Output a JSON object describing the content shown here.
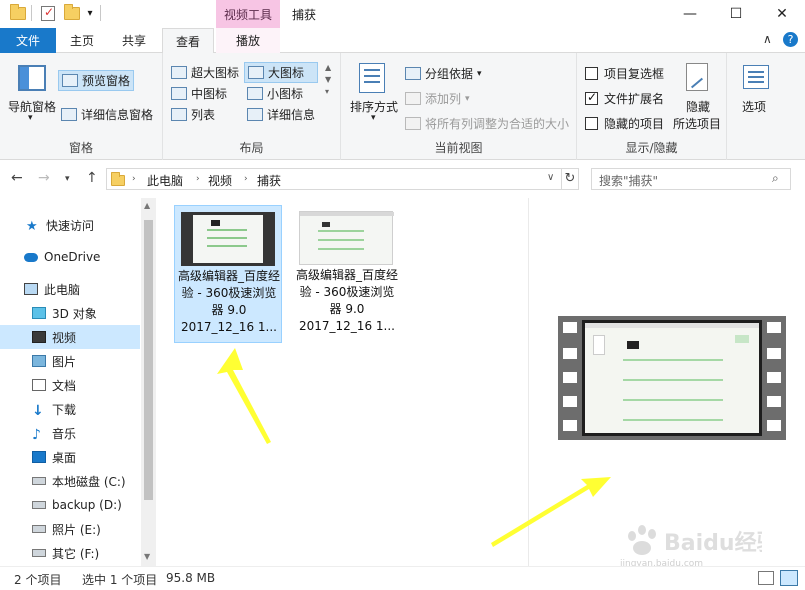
{
  "window": {
    "context_tool_label": "视频工具",
    "title": "捕获"
  },
  "tabs": {
    "file": "文件",
    "home": "主页",
    "share": "共享",
    "view": "查看",
    "play": "播放"
  },
  "ribbon": {
    "pane": {
      "nav_pane": "导航窗格",
      "preview_pane": "预览窗格",
      "details_pane": "详细信息窗格",
      "label": "窗格"
    },
    "layout": {
      "extra_large": "超大图标",
      "large": "大图标",
      "medium": "中图标",
      "small": "小图标",
      "list": "列表",
      "details": "详细信息",
      "label": "布局"
    },
    "current_view": {
      "sort_by": "排序方式",
      "group_by": "分组依据",
      "add_column": "添加列",
      "fit_columns": "将所有列调整为合适的大小",
      "label": "当前视图"
    },
    "show_hide": {
      "item_checkboxes": "项目复选框",
      "file_extensions": "文件扩展名",
      "hidden_items": "隐藏的项目",
      "hide_selected_1": "隐藏",
      "hide_selected_2": "所选项目",
      "label": "显示/隐藏"
    },
    "options": "选项"
  },
  "address": {
    "crumbs": [
      "此电脑",
      "视频",
      "捕获"
    ],
    "search_placeholder": "搜索\"捕获\""
  },
  "nav": {
    "items": [
      "快速访问",
      "OneDrive",
      "此电脑",
      "3D 对象",
      "视频",
      "图片",
      "文档",
      "下载",
      "音乐",
      "桌面",
      "本地磁盘 (C:)",
      "backup (D:)",
      "照片 (E:)",
      "其它 (F:)"
    ]
  },
  "files": [
    {
      "name": "高级编辑器_百度经验 - 360极速浏览器 9.0 2017_12_16 1..."
    },
    {
      "name": "高级编辑器_百度经验 - 360极速浏览器 9.0 2017_12_16 1..."
    }
  ],
  "status": {
    "count": "2 个项目",
    "selected": "选中 1 个项目",
    "size": "95.8 MB"
  },
  "watermark": {
    "line1": "Baidu经验",
    "line2": "jingyan.baidu.com"
  },
  "colors": {
    "file_tab": "#1979ca",
    "context_tab": "#f7c5e4",
    "selection": "#cce8ff",
    "arrow": "#ffff33"
  }
}
